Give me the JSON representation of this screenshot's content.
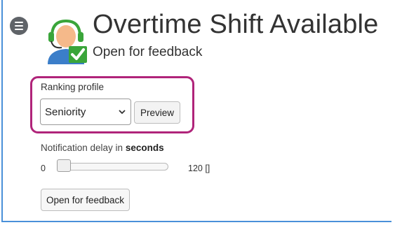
{
  "header": {
    "title": "Overtime Shift Available",
    "subtitle": "Open for feedback",
    "menu_icon": "hamburger-circle-icon",
    "avatar_icon": "support-agent-checkmark-icon"
  },
  "ranking": {
    "label": "Ranking profile",
    "selected": "Seniority",
    "preview_label": "Preview",
    "highlight_color": "#b0247a"
  },
  "delay": {
    "label_prefix": "Notification delay in ",
    "label_bold": "seconds",
    "min": "0",
    "max": "120 []",
    "value": 0
  },
  "actions": {
    "open_feedback_label": "Open for feedback"
  },
  "colors": {
    "frame_accent": "#4a90d9",
    "check_green": "#3aa53a"
  }
}
